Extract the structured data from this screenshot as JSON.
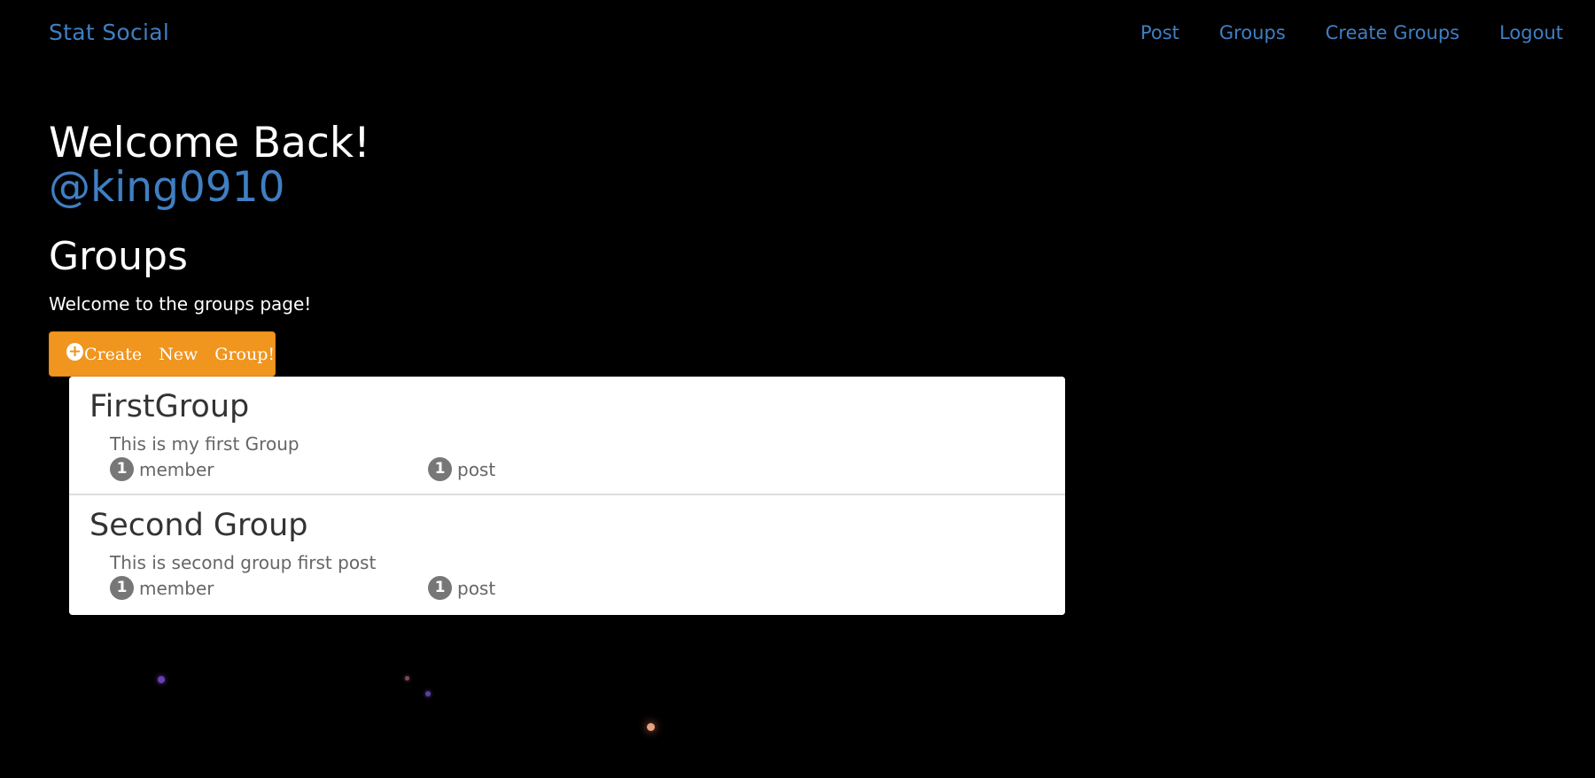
{
  "navbar": {
    "brand": "Stat Social",
    "links": [
      {
        "label": "Post"
      },
      {
        "label": "Groups"
      },
      {
        "label": "Create Groups"
      },
      {
        "label": "Logout"
      }
    ]
  },
  "main": {
    "welcome": "Welcome Back!",
    "username": "@king0910",
    "heading": "Groups",
    "intro": "Welcome to the groups page!",
    "create_button": {
      "icon": "plus-circle-icon",
      "words": [
        "Create",
        "New",
        "Group!"
      ]
    }
  },
  "groups": [
    {
      "name": "FirstGroup",
      "description": "This is my first Group",
      "member_count": "1",
      "member_label": "member",
      "post_count": "1",
      "post_label": "post"
    },
    {
      "name": "Second Group",
      "description": "This is second group first post",
      "member_count": "1",
      "member_label": "member",
      "post_count": "1",
      "post_label": "post"
    }
  ],
  "colors": {
    "background": "#000000",
    "link": "#3f7fc3",
    "button": "#f0951e",
    "badge": "#777777"
  }
}
